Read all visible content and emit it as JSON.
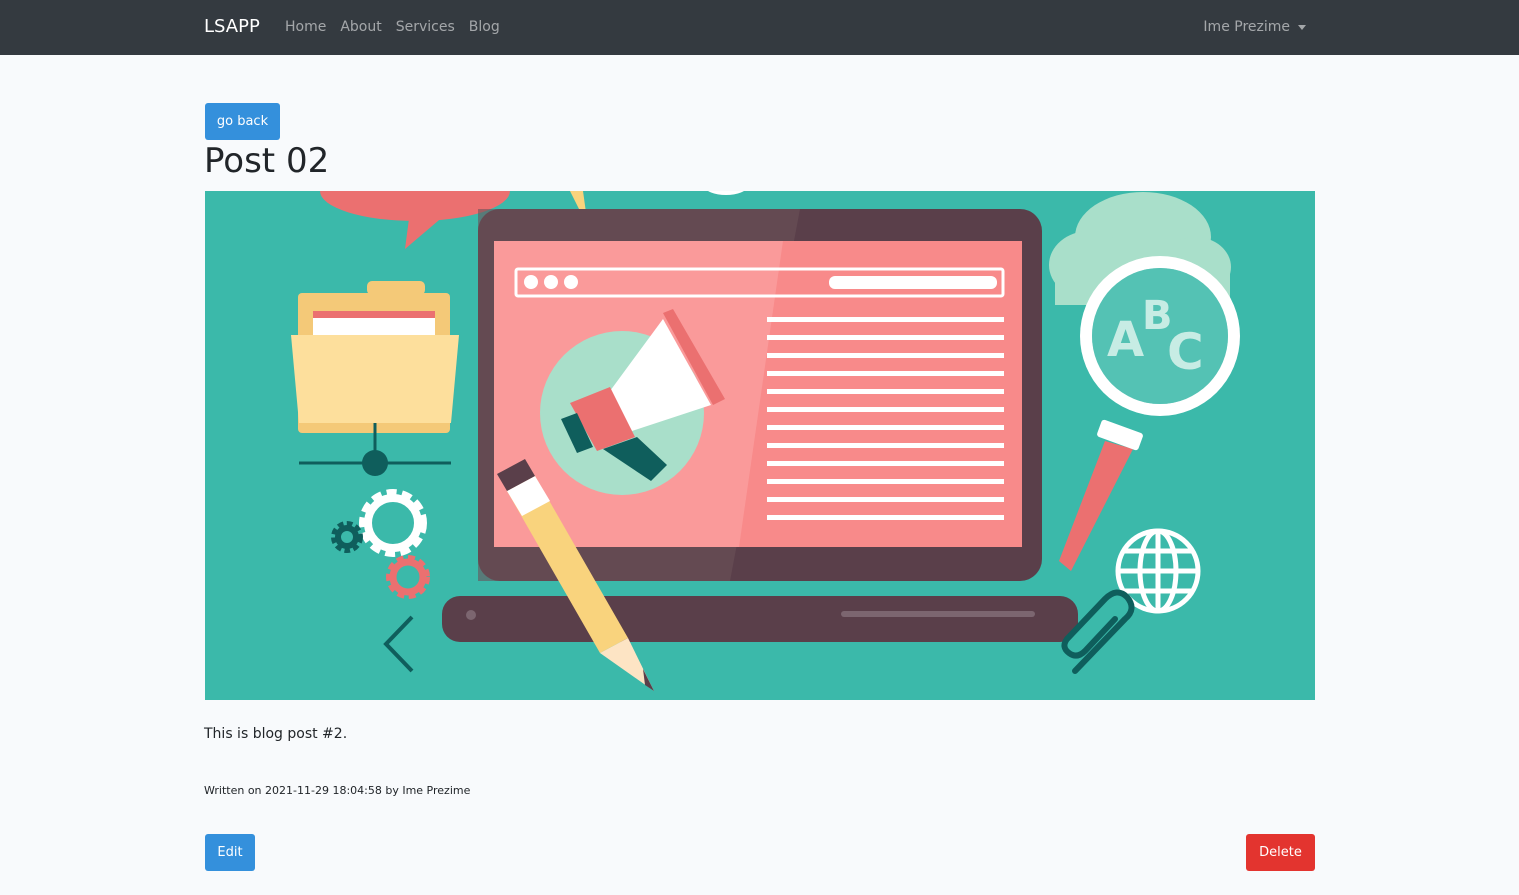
{
  "navbar": {
    "brand": "LSAPP",
    "links": [
      {
        "label": "Home"
      },
      {
        "label": "About"
      },
      {
        "label": "Services"
      },
      {
        "label": "Blog"
      }
    ],
    "user_name": "Ime Prezime"
  },
  "post": {
    "back_label": "go back",
    "title": "Post 02",
    "body": "This is blog post #2.",
    "meta": "Written on 2021-11-29 18:04:58 by Ime Prezime",
    "cover_image_letters": "ABC",
    "edit_label": "Edit",
    "delete_label": "Delete"
  },
  "colors": {
    "navbar_bg": "#343a40",
    "primary": "#3490dc",
    "danger": "#e3342f",
    "cover_bg": "#3bb9aa",
    "page_bg": "#f8fafc"
  }
}
